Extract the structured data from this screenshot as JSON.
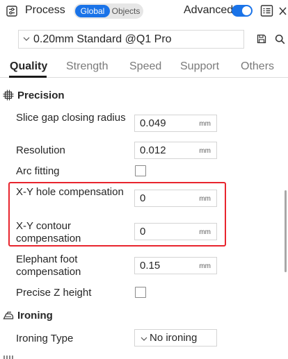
{
  "header": {
    "title": "Process",
    "mode_global": "Global",
    "mode_objects": "Objects",
    "advanced_label": "Advanced",
    "advanced_enabled": true,
    "accent": "#1a73e8"
  },
  "preset": {
    "value": "0.20mm Standard @Q1 Pro"
  },
  "tabs": [
    "Quality",
    "Strength",
    "Speed",
    "Support",
    "Others"
  ],
  "active_tab": "Quality",
  "sections": {
    "precision": {
      "title": "Precision",
      "icon": "precision-icon",
      "options": {
        "slice_gap": {
          "label": "Slice gap closing radius",
          "value": "0.049",
          "unit": "mm"
        },
        "resolution": {
          "label": "Resolution",
          "value": "0.012",
          "unit": "mm"
        },
        "arc_fitting": {
          "label": "Arc fitting",
          "checked": false
        },
        "xy_hole": {
          "label": "X-Y hole compensation",
          "value": "0",
          "unit": "mm"
        },
        "xy_contour": {
          "label": "X-Y contour compensation",
          "value": "0",
          "unit": "mm"
        },
        "elephant_foot": {
          "label": "Elephant foot compensation",
          "value": "0.15",
          "unit": "mm"
        },
        "precise_z": {
          "label": "Precise Z height",
          "checked": false
        }
      }
    },
    "ironing": {
      "title": "Ironing",
      "icon": "ironing-icon",
      "options": {
        "ironing_type": {
          "label": "Ironing Type",
          "value": "No ironing"
        }
      }
    }
  },
  "highlight_color": "#e8242d"
}
